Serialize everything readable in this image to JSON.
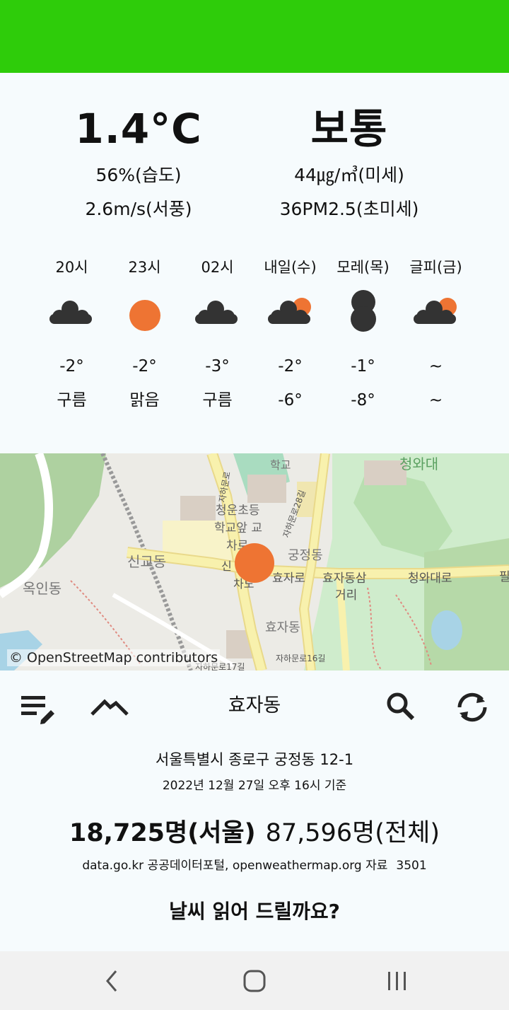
{
  "current": {
    "temperature": "1.4°C",
    "humidity": "56%(습도)",
    "wind": "2.6m/s(서풍)",
    "air_quality": "보통",
    "pm10": "44㎍/㎥(미세)",
    "pm25": "36PM2.5(초미세)"
  },
  "forecast": [
    {
      "time": "20시",
      "icon": "cloud-icon",
      "high": "-2°",
      "low": "구름"
    },
    {
      "time": "23시",
      "icon": "sun-icon",
      "high": "-2°",
      "low": "맑음"
    },
    {
      "time": "02시",
      "icon": "cloud-icon",
      "high": "-3°",
      "low": "구름"
    },
    {
      "time": "내일(수)",
      "icon": "cloud-sun-icon",
      "high": "-2°",
      "low": "-6°"
    },
    {
      "time": "모레(목)",
      "icon": "dark-clouds-icon",
      "high": "-1°",
      "low": "-8°"
    },
    {
      "time": "글피(금)",
      "icon": "cloud-sun-icon",
      "high": "~",
      "low": "~"
    }
  ],
  "map": {
    "credit": "© OpenStreetMap contributors",
    "labels": [
      "청와대",
      "학교",
      "청운초등 학교앞 교 차로",
      "궁정동",
      "신교동",
      "효자로",
      "효자동삼 거리",
      "청와대로",
      "옥인동",
      "효자동",
      "자하문로16길",
      "자하문로17길",
      "자하문로",
      "자하문로28길",
      "신 차로",
      "필"
    ],
    "marker_color": "#ee7433"
  },
  "toolbar": {
    "title": "효자동",
    "edit_icon": "edit-list-icon",
    "collapse_icon": "chevron-up-icon",
    "search_icon": "search-icon",
    "refresh_icon": "refresh-icon"
  },
  "info": {
    "address": "서울특별시 종로구 궁정동 12-1",
    "base_time": "2022년 12월 27일 오후 16시 기준",
    "seoul_count": "18,725명(서울)",
    "total_count": "87,596명(전체)",
    "source": "data.go.kr 공공데이터포털, openweathermap.org 자료",
    "source_number": "3501",
    "read_button": "날씨 읽어 드릴까요?"
  },
  "colors": {
    "header_green": "#2ecc0a",
    "sun_orange": "#ee7433",
    "cloud_dark": "#333333"
  }
}
